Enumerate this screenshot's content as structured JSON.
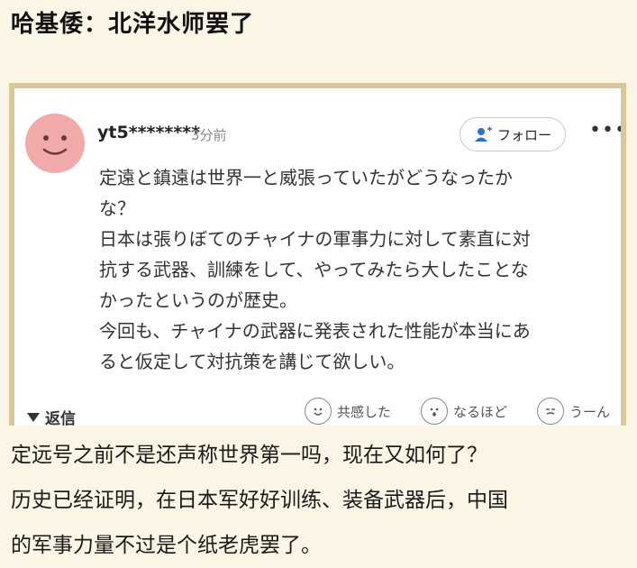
{
  "headline": "哈基倭：北洋水师罢了",
  "comment": {
    "username": "yt5********",
    "time": "3分前",
    "follow_label": "フォロー",
    "more_label": "•••",
    "lines": [
      "定遠と鎮遠は世界一と威張っていたがどうなったか",
      "な？",
      "日本は張りぼてのチャイナの軍事力に対して素直に対",
      "抗する武器、訓練をして、やってみたら大したことな",
      "かったというのが歴史。",
      "今回も、チャイナの武器に発表された性能が本当にあ",
      "ると仮定して対抗策を講じて欲しい。"
    ],
    "reply_label": "返信",
    "reactions": [
      {
        "label": "共感した",
        "icon": "smile-icon"
      },
      {
        "label": "なるほど",
        "icon": "surprised-icon"
      },
      {
        "label": "うーん",
        "icon": "hmm-icon"
      }
    ]
  },
  "body_lines": [
    "定远号之前不是还声称世界第一吗，现在又如何了？",
    "历史已经证明，在日本军好好训练、装备武器后，中国",
    "的军事力量不过是个纸老虎罢了。"
  ],
  "colors": {
    "page_background": "#fbf5e6",
    "card_border": "#d9c896",
    "avatar": "#f2a9a9"
  }
}
